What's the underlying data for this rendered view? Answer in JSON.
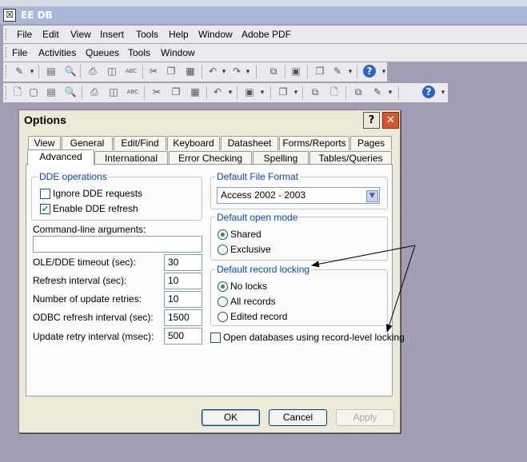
{
  "app": {
    "title": "EE DB",
    "icon_glyph": "☒"
  },
  "menubar1": {
    "items": [
      "File",
      "Edit",
      "View",
      "Insert",
      "Tools",
      "Help",
      "Window",
      "Adobe PDF"
    ]
  },
  "menubar2": {
    "items": [
      "File",
      "Activities",
      "Queues",
      "Tools",
      "Window"
    ]
  },
  "toolbar_icons": {
    "edit": "✎",
    "save": "▤",
    "search": "🔍",
    "print": "⎙",
    "preview": "◫",
    "spell": "ABC",
    "cut": "✂",
    "copy": "❐",
    "paste": "▦",
    "undo": "↶",
    "redo": "↷",
    "properties": "▣",
    "relationships": "⧉",
    "help": "?",
    "chevron": "▾",
    "new": "🗋",
    "open": "▢"
  },
  "dialog": {
    "title": "Options",
    "help_glyph": "?",
    "close_glyph": "✕",
    "tabs_row1": [
      "View",
      "General",
      "Edit/Find",
      "Keyboard",
      "Datasheet",
      "Forms/Reports",
      "Pages"
    ],
    "tabs_row2": [
      "Advanced",
      "International",
      "Error Checking",
      "Spelling",
      "Tables/Queries"
    ],
    "active_tab": "Advanced",
    "dde": {
      "label": "DDE operations",
      "ignore_label": "Ignore DDE requests",
      "ignore_checked": false,
      "enable_label": "Enable DDE refresh",
      "enable_checked": true,
      "check_glyph": "✔"
    },
    "cmdline": {
      "label": "Command-line arguments:",
      "value": ""
    },
    "fields": [
      {
        "label": "OLE/DDE timeout (sec):",
        "value": "30"
      },
      {
        "label": "Refresh interval (sec):",
        "value": "10"
      },
      {
        "label": "Number of update retries:",
        "value": "10"
      },
      {
        "label": "ODBC refresh interval (sec):",
        "value": "1500"
      },
      {
        "label": "Update retry interval (msec):",
        "value": "500"
      }
    ],
    "file_format": {
      "label": "Default File Format",
      "value": "Access 2002 - 2003",
      "arrow": "▼"
    },
    "open_mode": {
      "label": "Default open mode",
      "options": [
        "Shared",
        "Exclusive"
      ],
      "selected": "Shared"
    },
    "record_locking": {
      "label": "Default record locking",
      "options": [
        "No locks",
        "All records",
        "Edited record"
      ],
      "selected": "No locks"
    },
    "record_level": {
      "label": "Open databases using record-level locking",
      "checked": false
    },
    "buttons": {
      "ok": "OK",
      "cancel": "Cancel",
      "apply": "Apply"
    }
  }
}
